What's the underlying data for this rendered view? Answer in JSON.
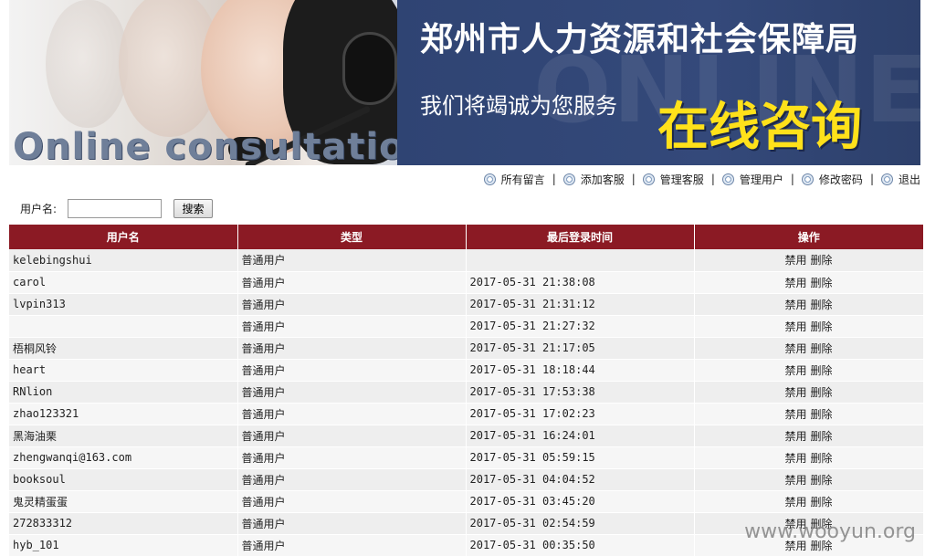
{
  "banner": {
    "title": "郑州市人力资源和社会保障局",
    "subtitle": "我们将竭诚为您服务",
    "online_cn": "在线咨询",
    "online_en": "Online consultation",
    "watermark": "ONLINE"
  },
  "nav": {
    "items": [
      {
        "label": "所有留言",
        "icon": "circle-arrow-icon"
      },
      {
        "label": "添加客服",
        "icon": "circle-arrow-icon"
      },
      {
        "label": "管理客服",
        "icon": "circle-arrow-icon"
      },
      {
        "label": "管理用户",
        "icon": "circle-arrow-icon"
      },
      {
        "label": "修改密码",
        "icon": "circle-arrow-icon"
      },
      {
        "label": "退出",
        "icon": "circle-arrow-icon"
      }
    ],
    "separator": "|"
  },
  "search": {
    "label": "用户名:",
    "value": "",
    "button": "搜索"
  },
  "table": {
    "headers": [
      "用户名",
      "类型",
      "最后登录时间",
      "操作"
    ],
    "disable_label": "禁用",
    "delete_label": "删除",
    "rows": [
      {
        "username": "kelebingshui",
        "type": "普通用户",
        "last_login": ""
      },
      {
        "username": "carol",
        "type": "普通用户",
        "last_login": "2017-05-31 21:38:08"
      },
      {
        "username": "lvpin313",
        "type": "普通用户",
        "last_login": "2017-05-31 21:31:12"
      },
      {
        "username": "",
        "type": "普通用户",
        "last_login": "2017-05-31 21:27:32"
      },
      {
        "username": "梧桐风铃",
        "type": "普通用户",
        "last_login": "2017-05-31 21:17:05"
      },
      {
        "username": "heart",
        "type": "普通用户",
        "last_login": "2017-05-31 18:18:44"
      },
      {
        "username": "RNlion",
        "type": "普通用户",
        "last_login": "2017-05-31 17:53:38"
      },
      {
        "username": "zhao123321",
        "type": "普通用户",
        "last_login": "2017-05-31 17:02:23"
      },
      {
        "username": "黑海油栗",
        "type": "普通用户",
        "last_login": "2017-05-31 16:24:01"
      },
      {
        "username": "zhengwanqi@163.com",
        "type": "普通用户",
        "last_login": "2017-05-31 05:59:15"
      },
      {
        "username": "booksoul",
        "type": "普通用户",
        "last_login": "2017-05-31 04:04:52"
      },
      {
        "username": "鬼灵精蛋蛋",
        "type": "普通用户",
        "last_login": "2017-05-31 03:45:20"
      },
      {
        "username": "272833312",
        "type": "普通用户",
        "last_login": "2017-05-31 02:54:59"
      },
      {
        "username": "hyb_101",
        "type": "普通用户",
        "last_login": "2017-05-31 00:35:50"
      }
    ]
  },
  "watermark": "www.wooyun.org",
  "colors": {
    "header_bg": "#8b1a24",
    "banner_bg": "#2f4473",
    "banner_accent": "#ffe11a"
  }
}
